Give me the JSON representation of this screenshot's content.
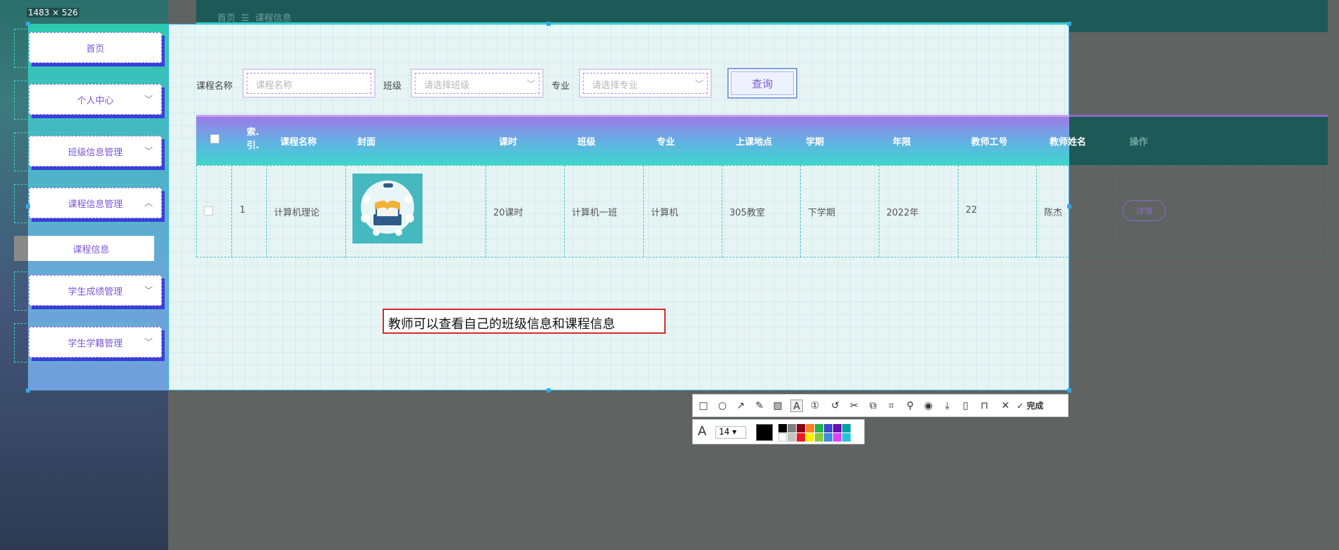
{
  "screenshot": {
    "size_label": "1483 × 526"
  },
  "breadcrumb": {
    "home": "首页",
    "sep": "☰",
    "current": "课程信息"
  },
  "sidebar": {
    "items": [
      {
        "label": "首页",
        "chevron": ""
      },
      {
        "label": "个人中心",
        "chevron": "﹀"
      },
      {
        "label": "班级信息管理",
        "chevron": "﹀"
      },
      {
        "label": "课程信息管理",
        "chevron": "︿"
      },
      {
        "label": "学生成绩管理",
        "chevron": "﹀"
      },
      {
        "label": "学生学籍管理",
        "chevron": "﹀"
      }
    ],
    "sub_item": "课程信息"
  },
  "search": {
    "course_label": "课程名称",
    "course_placeholder": "课程名称",
    "class_label": "班级",
    "class_placeholder": "请选择班级",
    "major_label": "专业",
    "major_placeholder": "请选择专业",
    "query_button": "查询"
  },
  "table": {
    "headers": [
      "索引",
      "课程名称",
      "封面",
      "课时",
      "班级",
      "专业",
      "上课地点",
      "学期",
      "年限",
      "教师工号",
      "教师姓名",
      "操作"
    ],
    "index_header_lines": [
      "索.",
      "引."
    ],
    "row": {
      "index": "1",
      "course": "计算机理论",
      "hours": "20课时",
      "class": "计算机一班",
      "major": "计算机",
      "location": "305教室",
      "term": "下学期",
      "year": "2022年",
      "teacher_id": "22",
      "teacher_name": "陈杰",
      "action": "详情"
    }
  },
  "annotation": {
    "text": "教师可以查看自己的班级信息和课程信息"
  },
  "toolbar": {
    "done_label": "完成",
    "font_size": "14"
  }
}
